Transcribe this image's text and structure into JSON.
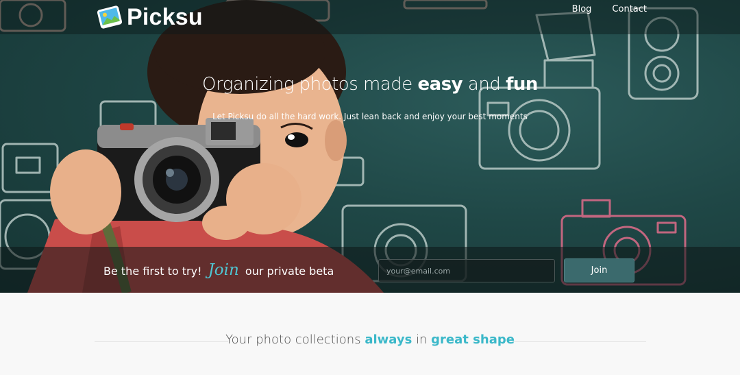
{
  "brand": {
    "name": "Picksu"
  },
  "nav": {
    "blog": "Blog",
    "contact": "Contact"
  },
  "hero": {
    "headline_pre": "Organizing photos made ",
    "headline_b1": "easy",
    "headline_mid": " and ",
    "headline_b2": "fun",
    "subline": "Let Picksu do all the hard work. Just lean back and enjoy your best moments"
  },
  "beta": {
    "pre": "Be the first to try!",
    "script": "Join",
    "post": "our private beta",
    "email_placeholder": "your@email.com",
    "join_label": "Join"
  },
  "section": {
    "pre": "Your photo collections ",
    "hl1": "always",
    "mid": " in ",
    "hl2": "great shape"
  },
  "colors": {
    "accent": "#3bb8c9",
    "button": "#3b6a6d",
    "hero_bg": "#1f4746"
  }
}
